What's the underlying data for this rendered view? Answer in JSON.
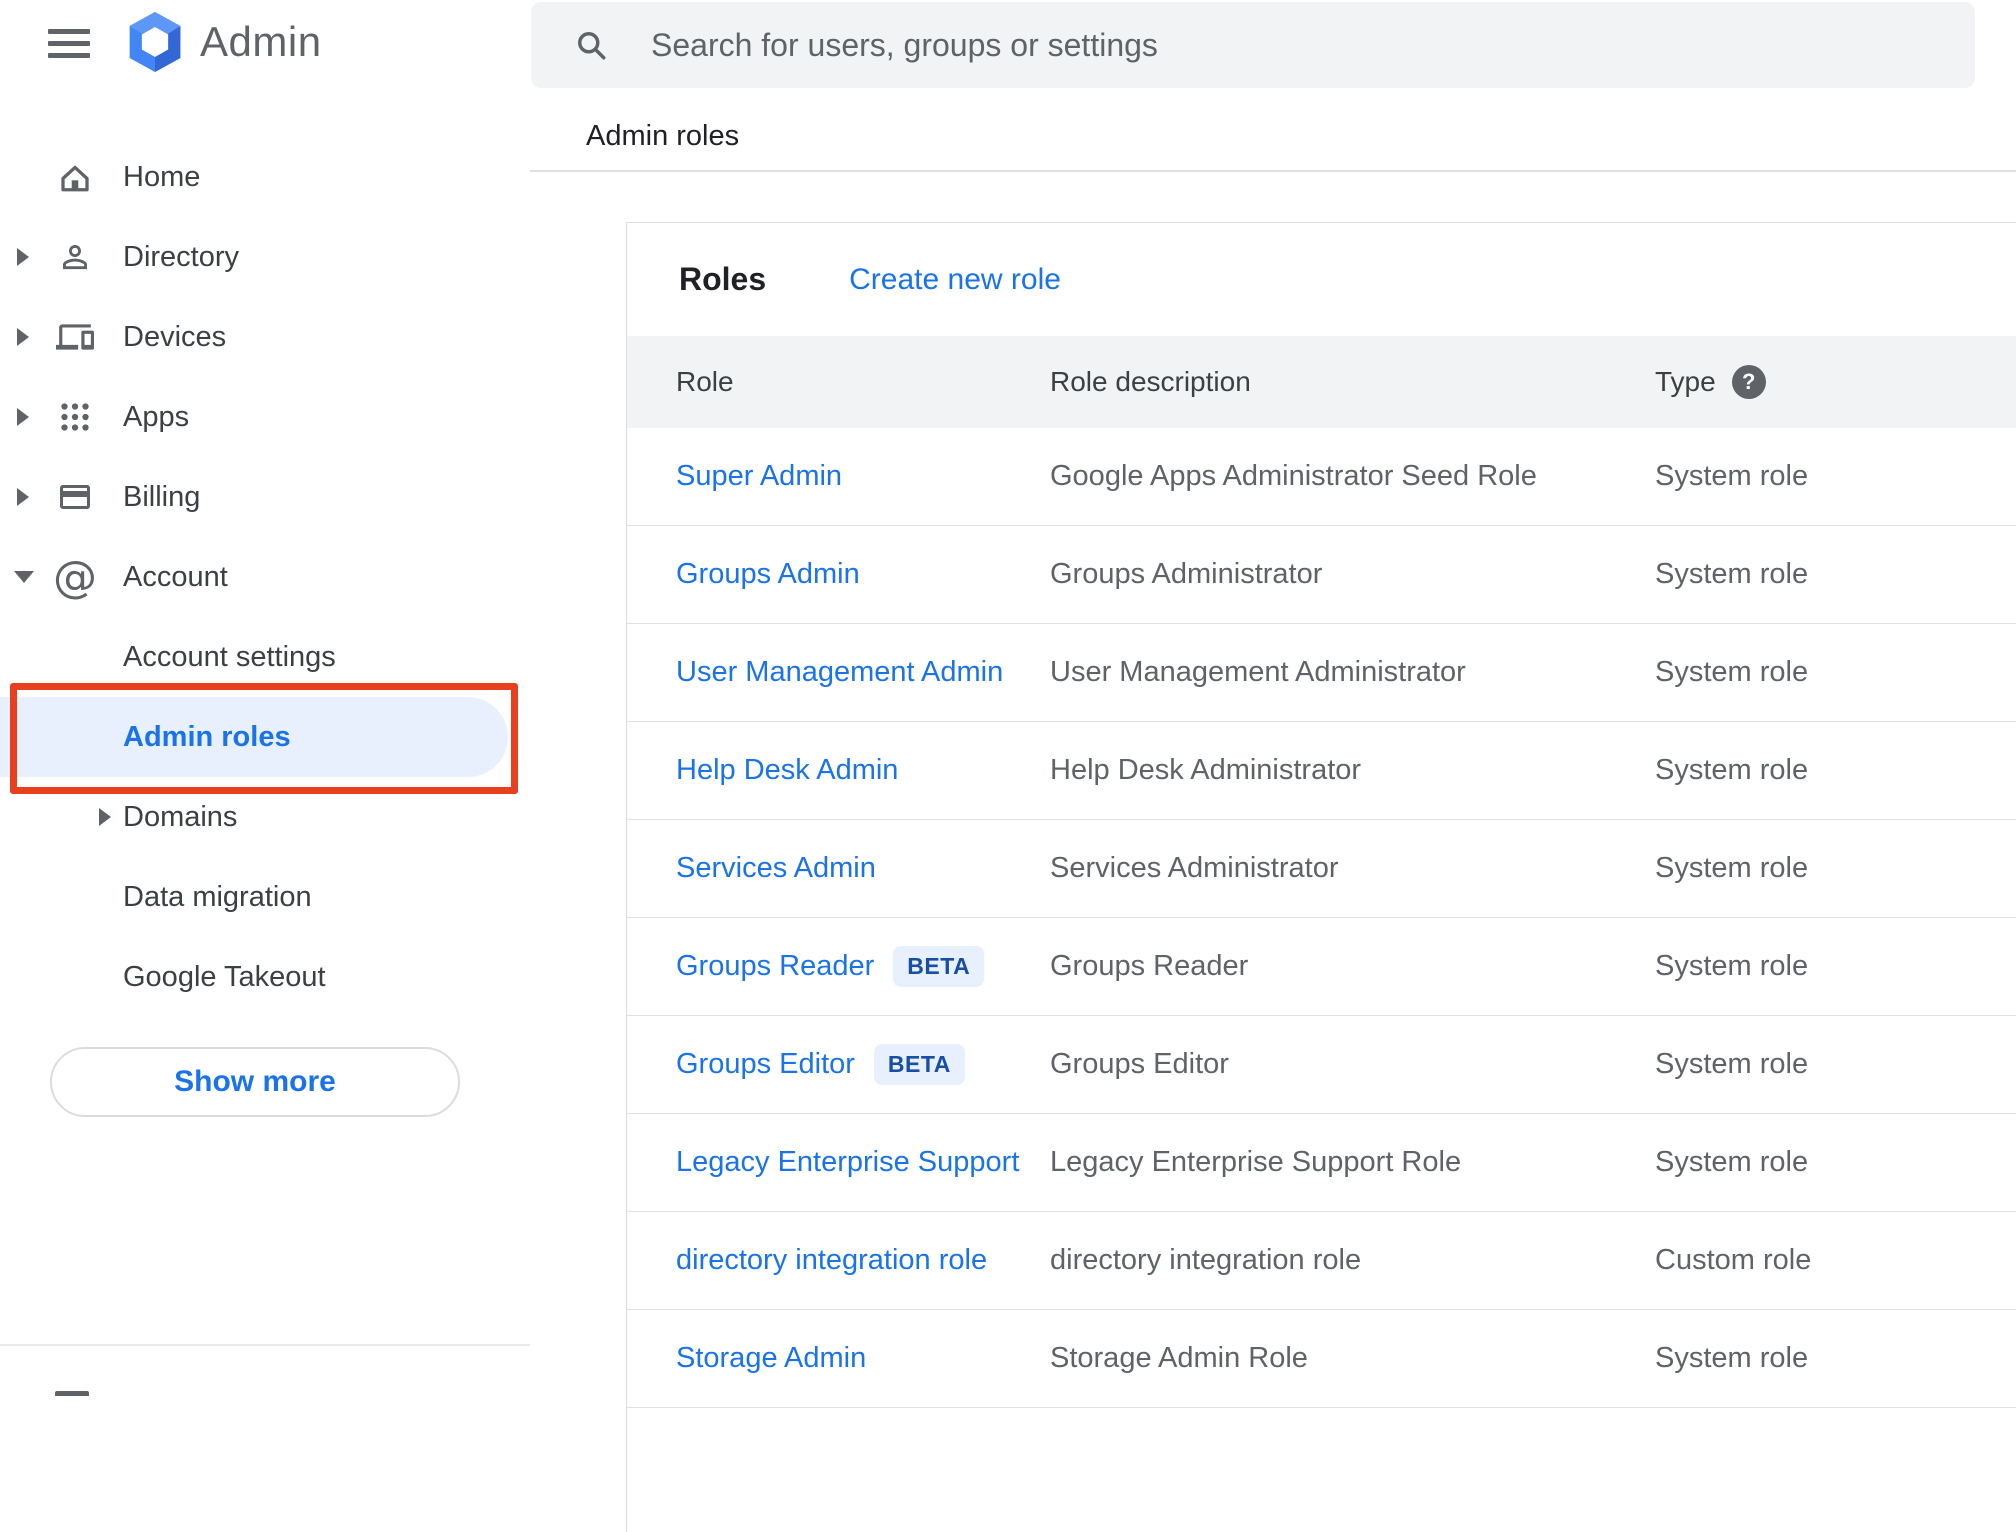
{
  "topbar": {
    "logo_text": "Admin",
    "search_placeholder": "Search for users, groups or settings"
  },
  "sidebar": {
    "items": [
      {
        "label": "Home",
        "icon": "home-icon",
        "expandable": false
      },
      {
        "label": "Directory",
        "icon": "person-icon",
        "expandable": true
      },
      {
        "label": "Devices",
        "icon": "devices-icon",
        "expandable": true
      },
      {
        "label": "Apps",
        "icon": "apps-grid-icon",
        "expandable": true
      },
      {
        "label": "Billing",
        "icon": "credit-card-icon",
        "expandable": true
      },
      {
        "label": "Account",
        "icon": "at-icon",
        "expandable": true,
        "expanded": true
      }
    ],
    "account_subitems": [
      {
        "label": "Account settings",
        "selected": false,
        "expandable": false
      },
      {
        "label": "Admin roles",
        "selected": true,
        "expandable": false
      },
      {
        "label": "Domains",
        "selected": false,
        "expandable": true
      },
      {
        "label": "Data migration",
        "selected": false,
        "expandable": false
      },
      {
        "label": "Google Takeout",
        "selected": false,
        "expandable": false
      }
    ],
    "show_more_label": "Show more"
  },
  "page": {
    "breadcrumb": "Admin roles",
    "card": {
      "title": "Roles",
      "create_link": "Create new role",
      "beta_label": "BETA",
      "table": {
        "columns": [
          "Role",
          "Role description",
          "Type"
        ],
        "rows": [
          {
            "role": "Super Admin",
            "beta": false,
            "description": "Google Apps Administrator Seed Role",
            "type": "System role"
          },
          {
            "role": "Groups Admin",
            "beta": false,
            "description": "Groups Administrator",
            "type": "System role"
          },
          {
            "role": "User Management Admin",
            "beta": false,
            "description": "User Management Administrator",
            "type": "System role"
          },
          {
            "role": "Help Desk Admin",
            "beta": false,
            "description": "Help Desk Administrator",
            "type": "System role"
          },
          {
            "role": "Services Admin",
            "beta": false,
            "description": "Services Administrator",
            "type": "System role"
          },
          {
            "role": "Groups Reader",
            "beta": true,
            "description": "Groups Reader",
            "type": "System role"
          },
          {
            "role": "Groups Editor",
            "beta": true,
            "description": "Groups Editor",
            "type": "System role"
          },
          {
            "role": "Legacy Enterprise Support",
            "beta": false,
            "description": "Legacy Enterprise Support Role",
            "type": "System role"
          },
          {
            "role": "directory integration role",
            "beta": false,
            "description": "directory integration role",
            "type": "Custom role"
          },
          {
            "role": "Storage Admin",
            "beta": false,
            "description": "Storage Admin Role",
            "type": "System role"
          }
        ]
      }
    }
  },
  "colors": {
    "accent_blue": "#1a73e8",
    "selected_bg": "#e8f0fe",
    "annotation_red": "#e8401f",
    "table_header_bg": "#f1f3f4",
    "search_bg": "#f1f3f4",
    "row_border": "#e0e0e0",
    "text_primary": "#202124",
    "text_secondary": "#5f6368",
    "sidebar_text": "#3c4043",
    "beta_text": "#174ea6",
    "logo_blue": "#4285f4"
  },
  "icons": {
    "question_glyph": "?"
  }
}
